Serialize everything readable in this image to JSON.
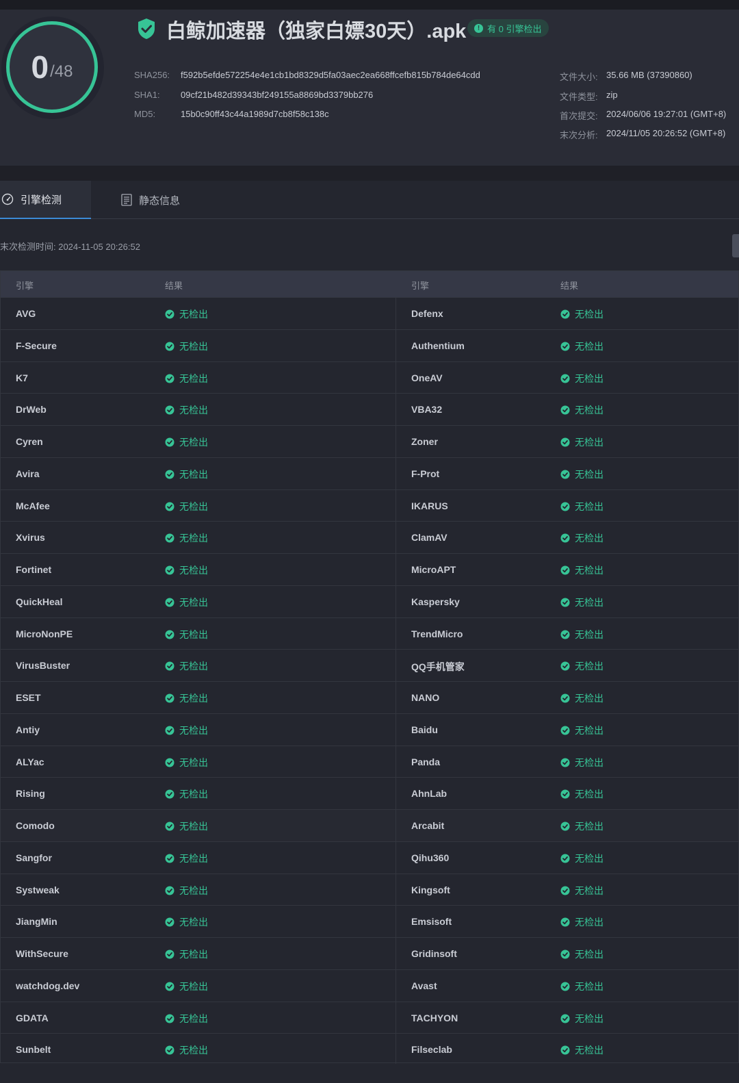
{
  "score": {
    "detected": "0",
    "total": "/48"
  },
  "file": {
    "title": "白鲸加速器（独家白嫖30天）.apk",
    "badge": "有 0 引擎检出",
    "hashes": [
      {
        "label": "SHA256:",
        "value": "f592b5efde572254e4e1cb1bd8329d5fa03aec2ea668ffcefb815b784de64cdd"
      },
      {
        "label": "SHA1:",
        "value": "09cf21b482d39343bf249155a8869bd3379bb276"
      },
      {
        "label": "MD5:",
        "value": "15b0c90ff43c44a1989d7cb8f58c138c"
      }
    ],
    "meta": [
      {
        "label": "文件大小:",
        "value": "35.66 MB (37390860)"
      },
      {
        "label": "文件类型:",
        "value": "zip"
      },
      {
        "label": "首次提交:",
        "value": "2024/06/06 19:27:01 (GMT+8)"
      },
      {
        "label": "末次分析:",
        "value": "2024/11/05 20:26:52 (GMT+8)"
      }
    ]
  },
  "tabs": {
    "engine": "引擎检测",
    "static": "静态信息"
  },
  "last_scan": "末次检测时间: 2024-11-05 20:26:52",
  "table": {
    "headers": {
      "engine_left": "引擎",
      "result_left": "结果",
      "engine_right": "引擎",
      "result_right": "结果"
    },
    "result_text": "无检出",
    "rows": [
      [
        "AVG",
        "Defenx"
      ],
      [
        "F-Secure",
        "Authentium"
      ],
      [
        "K7",
        "OneAV"
      ],
      [
        "DrWeb",
        "VBA32"
      ],
      [
        "Cyren",
        "Zoner"
      ],
      [
        "Avira",
        "F-Prot"
      ],
      [
        "McAfee",
        "IKARUS"
      ],
      [
        "Xvirus",
        "ClamAV"
      ],
      [
        "Fortinet",
        "MicroAPT"
      ],
      [
        "QuickHeal",
        "Kaspersky"
      ],
      [
        "MicroNonPE",
        "TrendMicro"
      ],
      [
        "VirusBuster",
        "QQ手机管家"
      ],
      [
        "ESET",
        "NANO"
      ],
      [
        "Antiy",
        "Baidu"
      ],
      [
        "ALYac",
        "Panda"
      ],
      [
        "Rising",
        "AhnLab"
      ],
      [
        "Comodo",
        "Arcabit"
      ],
      [
        "Sangfor",
        "Qihu360"
      ],
      [
        "Systweak",
        "Kingsoft"
      ],
      [
        "JiangMin",
        "Emsisoft"
      ],
      [
        "WithSecure",
        "Gridinsoft"
      ],
      [
        "watchdog.dev",
        "Avast"
      ],
      [
        "GDATA",
        "TACHYON"
      ],
      [
        "Sunbelt",
        "Filseclab"
      ]
    ]
  },
  "colors": {
    "accent": "#37c496",
    "tab_underline": "#3c8bd6"
  },
  "icons": {
    "shield": "shield-check-icon",
    "badge": "exclamation-icon",
    "result": "check-circle-icon",
    "tab_engine": "gauge-icon",
    "tab_static": "document-list-icon"
  }
}
